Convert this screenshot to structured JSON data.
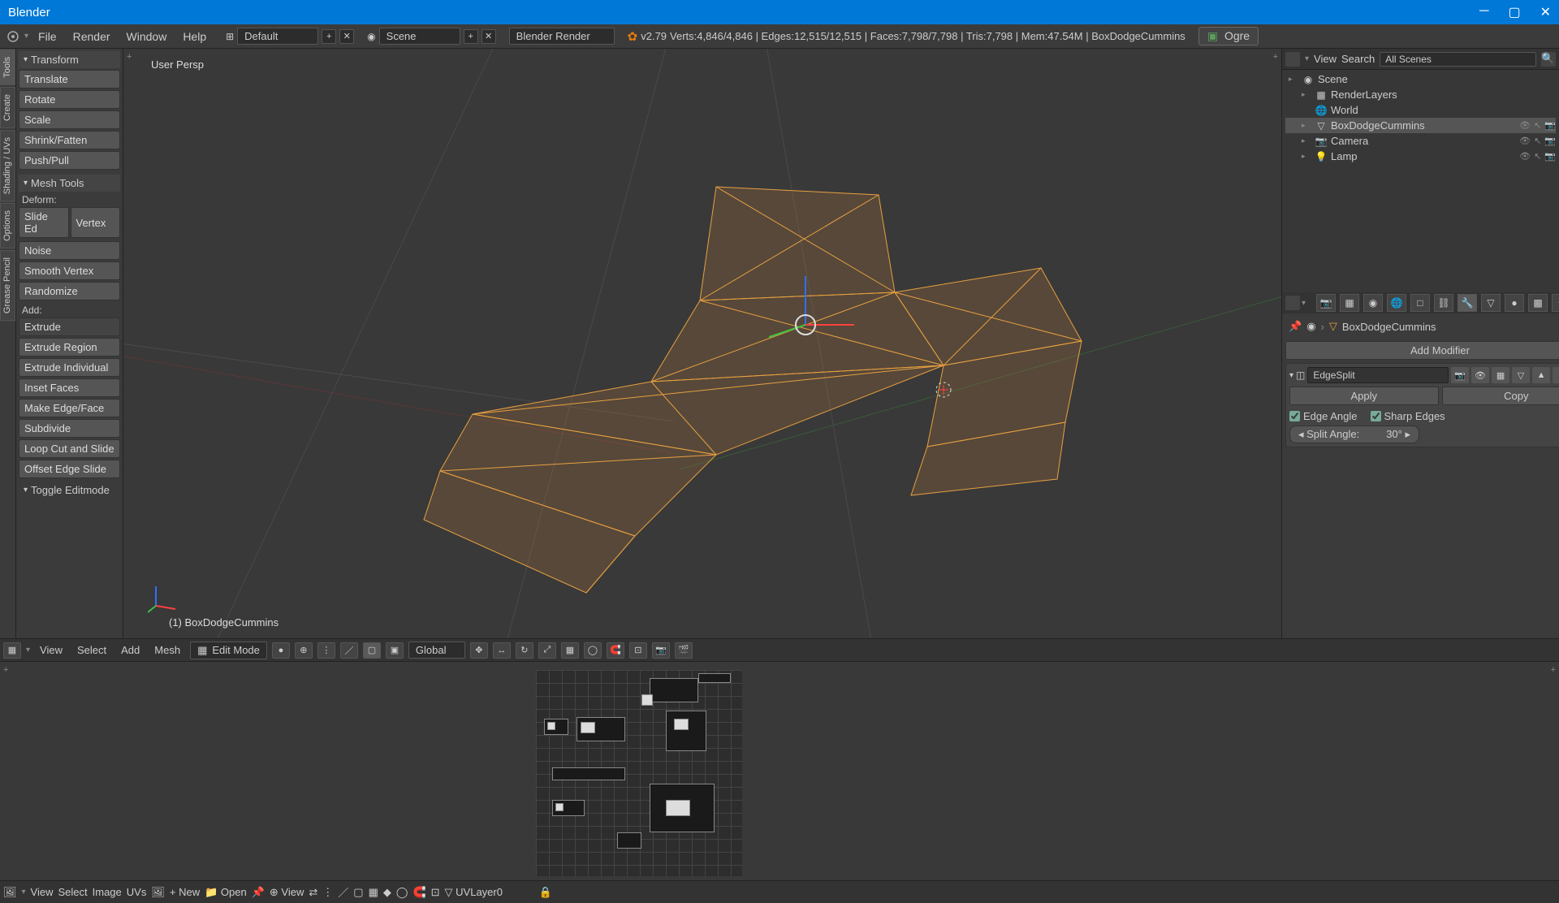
{
  "app": {
    "title": "Blender"
  },
  "menubar": {
    "items": [
      "File",
      "Render",
      "Window",
      "Help"
    ],
    "layout": "Default",
    "scene": "Scene",
    "render_engine": "Blender Render",
    "version": "v2.79",
    "stats": "Verts:4,846/4,846 | Edges:12,515/12,515 | Faces:7,798/7,798 | Tris:7,798 | Mem:47.54M | BoxDodgeCummins",
    "addon_btn": "Ogre"
  },
  "toolshelf": {
    "tabs": [
      "Tools",
      "Create",
      "Shading / UVs",
      "Options",
      "Grease Pencil"
    ],
    "transform": {
      "header": "Transform",
      "buttons": [
        "Translate",
        "Rotate",
        "Scale",
        "Shrink/Fatten",
        "Push/Pull"
      ]
    },
    "meshtools": {
      "header": "Mesh Tools",
      "deform_label": "Deform:",
      "deform_row": [
        "Slide Ed",
        "Vertex"
      ],
      "deform_btns": [
        "Noise",
        "Smooth Vertex",
        "Randomize"
      ],
      "add_label": "Add:",
      "extrude_dropdown": "Extrude",
      "add_btns": [
        "Extrude Region",
        "Extrude Individual",
        "Inset Faces",
        "Make Edge/Face",
        "Subdivide",
        "Loop Cut and Slide",
        "Offset Edge Slide"
      ]
    },
    "history": {
      "header": "Toggle Editmode"
    }
  },
  "viewport": {
    "persp_label": "User Persp",
    "object_label": "(1) BoxDodgeCummins"
  },
  "view3d_header": {
    "menus": [
      "View",
      "Select",
      "Add",
      "Mesh"
    ],
    "mode": "Edit Mode",
    "orientation": "Global"
  },
  "outliner": {
    "menus": [
      "View",
      "Search"
    ],
    "filter": "All Scenes",
    "tree": [
      {
        "depth": 0,
        "icon": "scene-icon",
        "label": "Scene",
        "expanded": true
      },
      {
        "depth": 1,
        "icon": "renderlayer-icon",
        "label": "RenderLayers",
        "extra": true
      },
      {
        "depth": 1,
        "icon": "world-icon",
        "label": "World"
      },
      {
        "depth": 1,
        "icon": "mesh-icon",
        "label": "BoxDodgeCummins",
        "active": true,
        "vis": true
      },
      {
        "depth": 1,
        "icon": "camera-icon",
        "label": "Camera",
        "vis": true
      },
      {
        "depth": 1,
        "icon": "lamp-icon",
        "label": "Lamp",
        "vis": true
      }
    ]
  },
  "properties": {
    "breadcrumb_object": "BoxDodgeCummins",
    "add_modifier": "Add Modifier",
    "modifier": {
      "name": "EdgeSplit",
      "apply": "Apply",
      "copy": "Copy",
      "edge_angle_label": "Edge Angle",
      "edge_angle": true,
      "sharp_edges_label": "Sharp Edges",
      "sharp_edges": true,
      "split_label": "Split Angle:",
      "split_value": "30°"
    }
  },
  "uv_header": {
    "menus": [
      "View",
      "Select",
      "Image",
      "UVs"
    ],
    "new": "New",
    "open": "Open",
    "view_menu": "View",
    "uv_layer": "UVLayer0"
  }
}
